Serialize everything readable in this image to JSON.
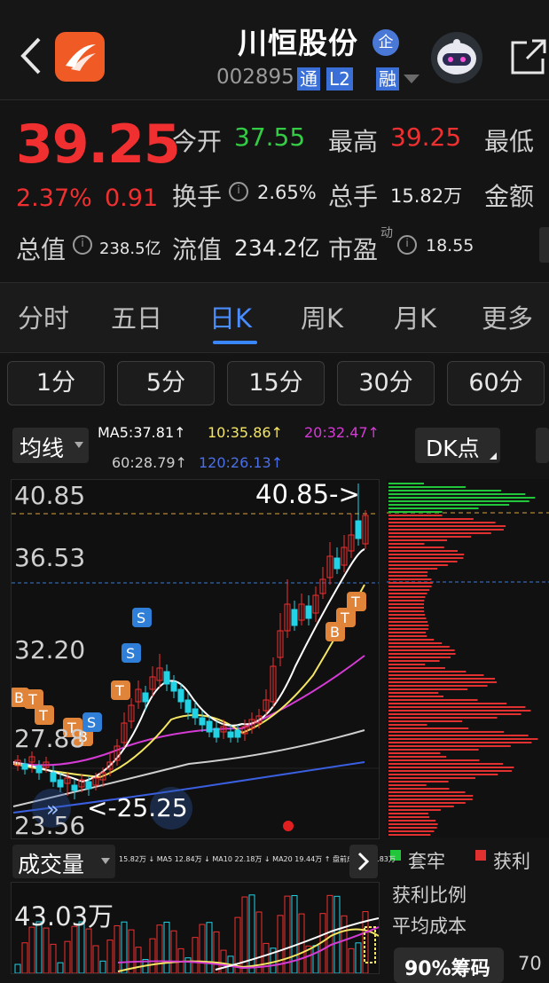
{
  "header": {
    "title": "川恒股份",
    "badge": "企",
    "code": "002895",
    "tags": [
      "通",
      "L2",
      "融"
    ]
  },
  "quote": {
    "price": "39.25",
    "change_pct": "2.37%",
    "change": "0.91",
    "open_label": "今开",
    "open": "37.55",
    "high_label": "最高",
    "high": "39.25",
    "low_label": "最低",
    "turnover_label": "换手",
    "turnover": "2.65%",
    "volume_label": "总手",
    "volume": "15.82万",
    "amount_label": "金额",
    "mktcap_label": "总值",
    "mktcap": "238.5亿",
    "float_label": "流值",
    "float": "234.2亿",
    "pe_label": "市盈",
    "pe_sup": "动",
    "pe": "18.55"
  },
  "tabs": [
    "分时",
    "五日",
    "日K",
    "周K",
    "月K",
    "更多"
  ],
  "active_tab": "日K",
  "periods": [
    "1分",
    "5分",
    "15分",
    "30分",
    "60分"
  ],
  "indicator": {
    "selector": "均线",
    "ma5": "MA5:37.81↑",
    "ma10": "10:35.86↑",
    "ma20": "20:32.47↑",
    "ma60": "60:28.79↑",
    "ma120": "120:26.13↑",
    "dk_button": "DK点"
  },
  "chart": {
    "y_labels": [
      "40.85",
      "36.53",
      "32.20",
      "27.88",
      "23.56"
    ],
    "high_marker": "40.85->",
    "low_marker": "<-25.25",
    "colors": {
      "up": "#f03030",
      "down": "#22d3e6",
      "ma5": "#ffffff",
      "ma10": "#f5e663",
      "ma20": "#d43bd4",
      "ma60": "#cfcfcf",
      "ma120": "#3a5fe0"
    }
  },
  "volume_panel": {
    "selector": "成交量",
    "legend": "15.82万 ↓ MA5 12.84万 ↓ MA10 22.18万 ↓ MA20 19.44万 ↑ 盘前成交量25.83万",
    "y_label": "43.03万"
  },
  "side": {
    "legend_trapped": "套牢",
    "legend_profit": "获利",
    "profit_ratio": "获利比例",
    "avg_cost": "平均成本",
    "chip_button": "90%筹码",
    "chip_value": "70"
  }
}
